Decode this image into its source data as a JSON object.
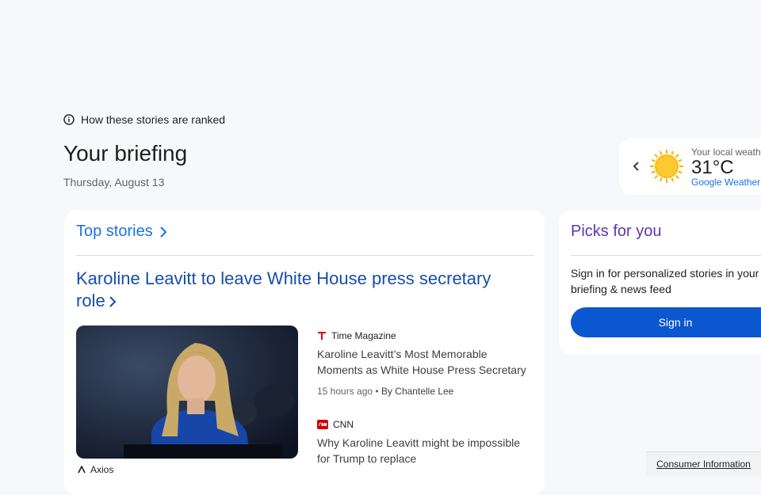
{
  "ranked_link": "How these stories are ranked",
  "briefing": {
    "title": "Your briefing",
    "date": "Thursday, August 13"
  },
  "weather": {
    "label": "Your local weather",
    "temp": "31°C",
    "link": "Google Weather",
    "icon": "sun-icon"
  },
  "top_stories": {
    "header": "Top stories",
    "headline": "Karoline Leavitt to leave White House press secretary role",
    "hero_source": "Axios",
    "stories": [
      {
        "source": "Time Magazine",
        "title": "Karoline Leavitt’s Most Memorable Moments as White House Press Secretary",
        "time": "15 hours ago",
        "author": "By Chantelle Lee"
      },
      {
        "source": "CNN",
        "title": "Why Karoline Leavitt might be impossible for Trump to replace"
      }
    ]
  },
  "picks": {
    "title": "Picks for you",
    "text": "Sign in for personalized stories in your briefing & news feed",
    "button": "Sign in"
  },
  "footer": {
    "consumer_info": "Consumer Information"
  },
  "colors": {
    "accent": "#1a73e8",
    "headline": "#174ea6",
    "picks": "#5e35b1",
    "button": "#0b57d0"
  }
}
